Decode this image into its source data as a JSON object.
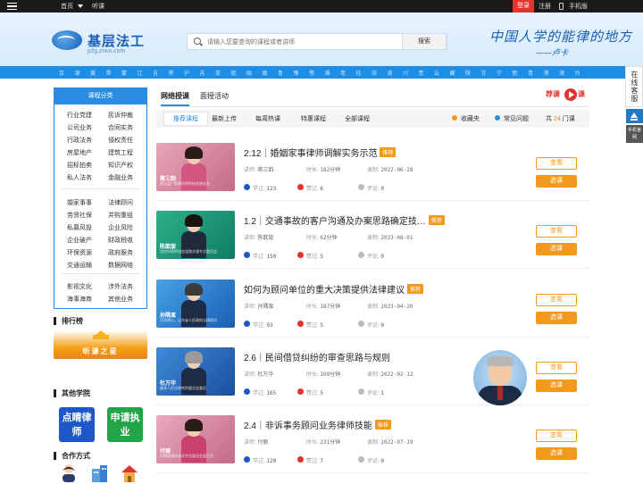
{
  "topbar": {
    "home": "首页",
    "listen": "听课",
    "login": "登录",
    "register": "注册",
    "mobile": "手机版"
  },
  "header": {
    "logo_title": "基层法工",
    "logo_sub": "jcfg.zrwx.com",
    "search_placeholder": "请输入您要查询的课程或者讲师",
    "search_button": "搜索",
    "slogan": "中国人学的能律的地方",
    "slogan_sign": "——卢卡"
  },
  "provinces": [
    "京",
    "津",
    "冀",
    "晋",
    "蒙",
    "辽",
    "吉",
    "黑",
    "沪",
    "苏",
    "浙",
    "皖",
    "闽",
    "赣",
    "鲁",
    "豫",
    "鄂",
    "湘",
    "粤",
    "桂",
    "琼",
    "渝",
    "川",
    "贵",
    "云",
    "藏",
    "陕",
    "甘",
    "宁",
    "新",
    "青",
    "港",
    "澳",
    "台"
  ],
  "float": {
    "online": "在线客服",
    "mobile": "手机官网"
  },
  "sidebar": {
    "category_title": "课程分类",
    "categories_left": [
      "行业党建",
      "公司业务",
      "行政法务",
      "房屋地产",
      "招标拍卖",
      "私人法务",
      "婚家事事",
      "劳资社保",
      "私募风投",
      "企业破产",
      "环保资源",
      "交通运输",
      "影视文化",
      "海事海商"
    ],
    "categories_right": [
      "民诉仲裁",
      "合同实务",
      "侵权责任",
      "建筑工程",
      "知识产权",
      "金融业务",
      "法律顾问",
      "并购重组",
      "企业风险",
      "财政税收",
      "政府服务",
      "数据网络",
      "涉外法务",
      "其他业务"
    ],
    "ranking_title": "排行榜",
    "ranking_banner": "听课之星",
    "other_title": "其他学院",
    "promo1": "点睛律师",
    "promo2": "申请执业",
    "coop_title": "合作方式"
  },
  "main": {
    "tab_online": "网络授课",
    "tab_offline": "面授活动",
    "brand_left": "荐课",
    "brand_right": "课",
    "subtabs": [
      "推荐课程",
      "最新上传",
      "每周热课",
      "特惠课程",
      "全部课程"
    ],
    "favorites": "收藏夹",
    "faq": "常见问题",
    "count_prefix": "共",
    "count": "24",
    "count_suffix": "门课"
  },
  "labels": {
    "teacher": "讲师:",
    "duration": "时长:",
    "recorded": "录制:",
    "studied": "学过:",
    "liked": "赞过:",
    "comments": "评论:",
    "view": "查看",
    "select": "选课",
    "recommend": "推荐"
  },
  "courses": [
    {
      "title": "2.12｜婚姻家事律师调解实务示范",
      "teacher": "蒋三韵",
      "duration": "182分钟",
      "date": "2022-06-28",
      "studied": "123",
      "liked": "6",
      "comments": "0",
      "thumb_name": "蒋三韵",
      "thumb_desc": "第五届广西建设律师协会副会长"
    },
    {
      "title": "1.2｜交通事故的客户沟通及办案思路确定技…",
      "teacher": "陈歆旋",
      "duration": "62分钟",
      "date": "2023-08-01",
      "studied": "150",
      "liked": "5",
      "comments": "0",
      "thumb_name": "陈歆旋",
      "thumb_desc": "北京市律师协会道路交通专业委员会"
    },
    {
      "title": "如何为顾问单位的重大决策提供法律建议",
      "teacher": "孙隅蛮",
      "duration": "187分钟",
      "date": "2023-04-20",
      "studied": "93",
      "liked": "5",
      "comments": "0",
      "thumb_name": "孙隅蛮",
      "thumb_desc": "法学博士，山东省人民政府法律顾问"
    },
    {
      "title": "2.6｜民间借贷纠纷的审查思路与规则",
      "teacher": "杜万华",
      "duration": "109分钟",
      "date": "2022-02-12",
      "studied": "165",
      "liked": "5",
      "comments": "1",
      "thumb_name": "杜万华",
      "thumb_desc": "最高人民法院审判委员会委员"
    },
    {
      "title": "2.4｜非诉事务顾问业务律师技能",
      "teacher": "付丽",
      "duration": "231分钟",
      "date": "2022-07-19",
      "studied": "120",
      "liked": "7",
      "comments": "0",
      "thumb_name": "付丽",
      "thumb_desc": "河南省律协非诉专业委员会副主任"
    }
  ],
  "colors": {
    "accent": "#2a8ce0",
    "orange": "#f39a1e",
    "red": "#e5322d"
  }
}
